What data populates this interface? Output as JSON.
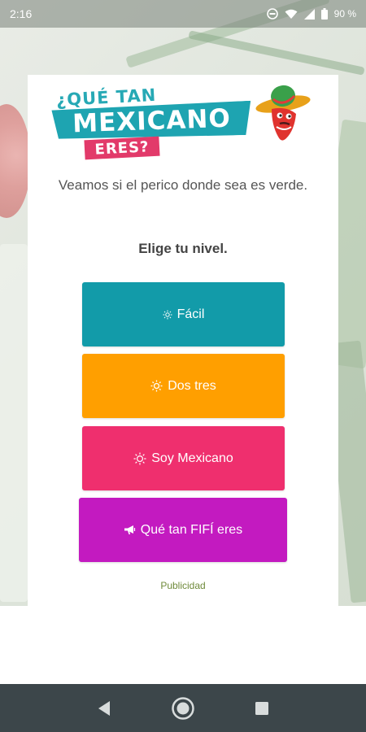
{
  "status_bar": {
    "time": "2:16",
    "battery": "90 %"
  },
  "logo": {
    "line1": "¿QUÉ TAN",
    "line2": "MEXICANO",
    "line3": "ERES?"
  },
  "intro": {
    "text": "Veamos si el perico donde sea es verde.",
    "heading": "Elige tu nivel."
  },
  "levels": [
    {
      "label": "Fácil",
      "icon": "sun-small-icon",
      "color": "#129ba9"
    },
    {
      "label": "Dos tres",
      "icon": "sun-medium-icon",
      "color": "#ff9f00"
    },
    {
      "label": "Soy Mexicano",
      "icon": "sun-outline-icon",
      "color": "#ef2f6e"
    },
    {
      "label": "Qué tan FIFÍ eres",
      "icon": "megaphone-icon",
      "color": "#c31ac0"
    }
  ],
  "ad": {
    "label": "Publicidad"
  },
  "nav": {
    "back": "back-icon",
    "home": "home-icon",
    "recents": "recents-icon"
  }
}
